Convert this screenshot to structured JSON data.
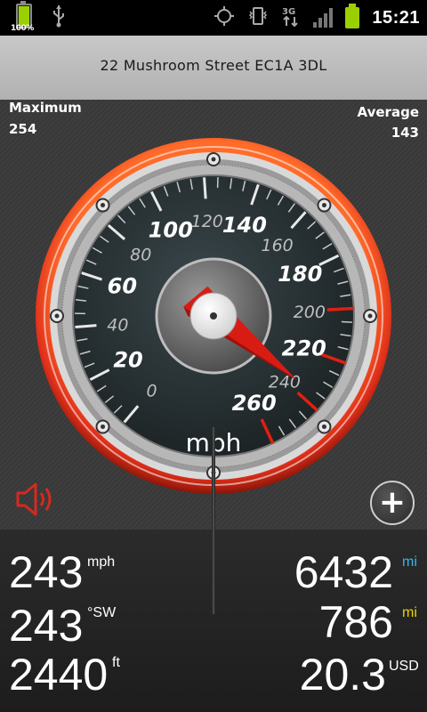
{
  "status_bar": {
    "battery_percent_label": "100%",
    "time": "15:21",
    "icons": [
      "battery-icon",
      "usb-icon",
      "gps-icon",
      "vibrate-icon",
      "3g-icon",
      "signal-icon",
      "battery-icon"
    ]
  },
  "header": {
    "address": "22 Mushroom Street EC1A 3DL"
  },
  "stats": {
    "maximum_label": "Maximum",
    "maximum_value": "254",
    "average_label": "Average",
    "average_value": "143"
  },
  "gauge": {
    "unit": "mph",
    "ticks": [
      "0",
      "20",
      "40",
      "60",
      "80",
      "100",
      "120",
      "140",
      "160",
      "180",
      "200",
      "220",
      "240",
      "260"
    ],
    "speed": 243,
    "max_scale": 260,
    "colors": {
      "ring": "#e0301a",
      "needle": "#e02020",
      "face": "#2b3437"
    }
  },
  "readouts": {
    "left": [
      {
        "value": "243",
        "unit": "mph"
      },
      {
        "value": "243",
        "unit": "°SW"
      },
      {
        "value": "2440",
        "unit": "ft"
      }
    ],
    "right": [
      {
        "value": "6432",
        "unit": "mi",
        "unit_color": "#3ab4e8"
      },
      {
        "value": "786",
        "unit": "mi",
        "unit_color": "#e8d100"
      },
      {
        "value": "20.3",
        "unit": "USD",
        "unit_color": "#ffffff"
      }
    ]
  }
}
